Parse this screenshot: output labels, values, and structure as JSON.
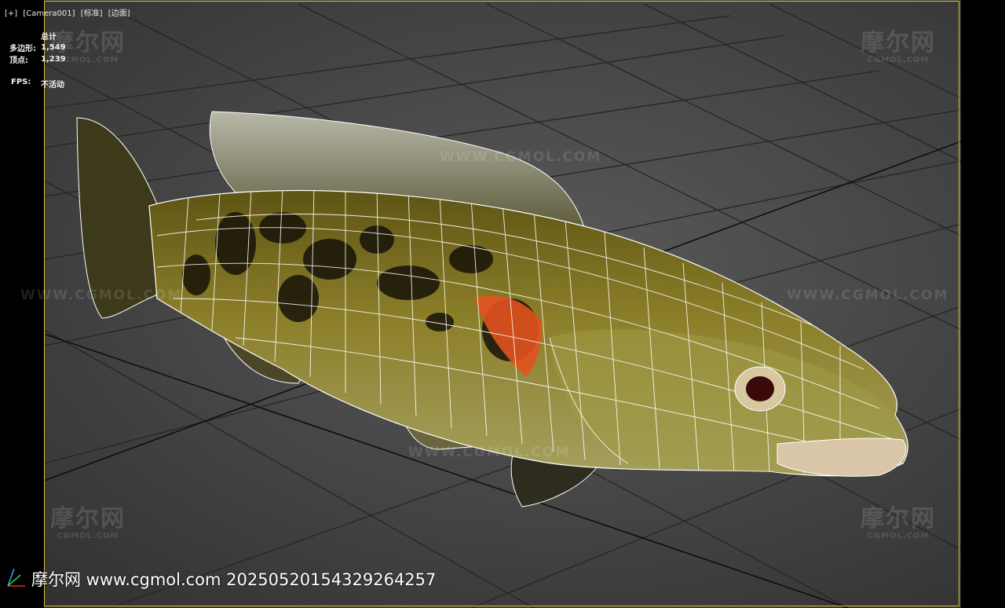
{
  "viewport": {
    "label_items": [
      "[+]",
      "[Camera001]",
      "[标准]",
      "[边面]"
    ]
  },
  "stats": {
    "header": "总计",
    "polygons_label": "多边形:",
    "polygons_value": "1,549",
    "vertices_label": "顶点:",
    "vertices_value": "1,239",
    "fps_label": "FPS:",
    "fps_value": "不活动"
  },
  "watermarks": {
    "cn": "摩尔网",
    "url": "CGMOL.COM",
    "line_text": "WWW.CGMOL.COM"
  },
  "footer": {
    "text": "摩尔网 www.cgmol.com 20250520154329264257"
  },
  "colors": {
    "frame": "#d6c23a",
    "wire": "#ffffff",
    "fish_body": "#7a6f22",
    "fin_orange": "#e2521e"
  }
}
